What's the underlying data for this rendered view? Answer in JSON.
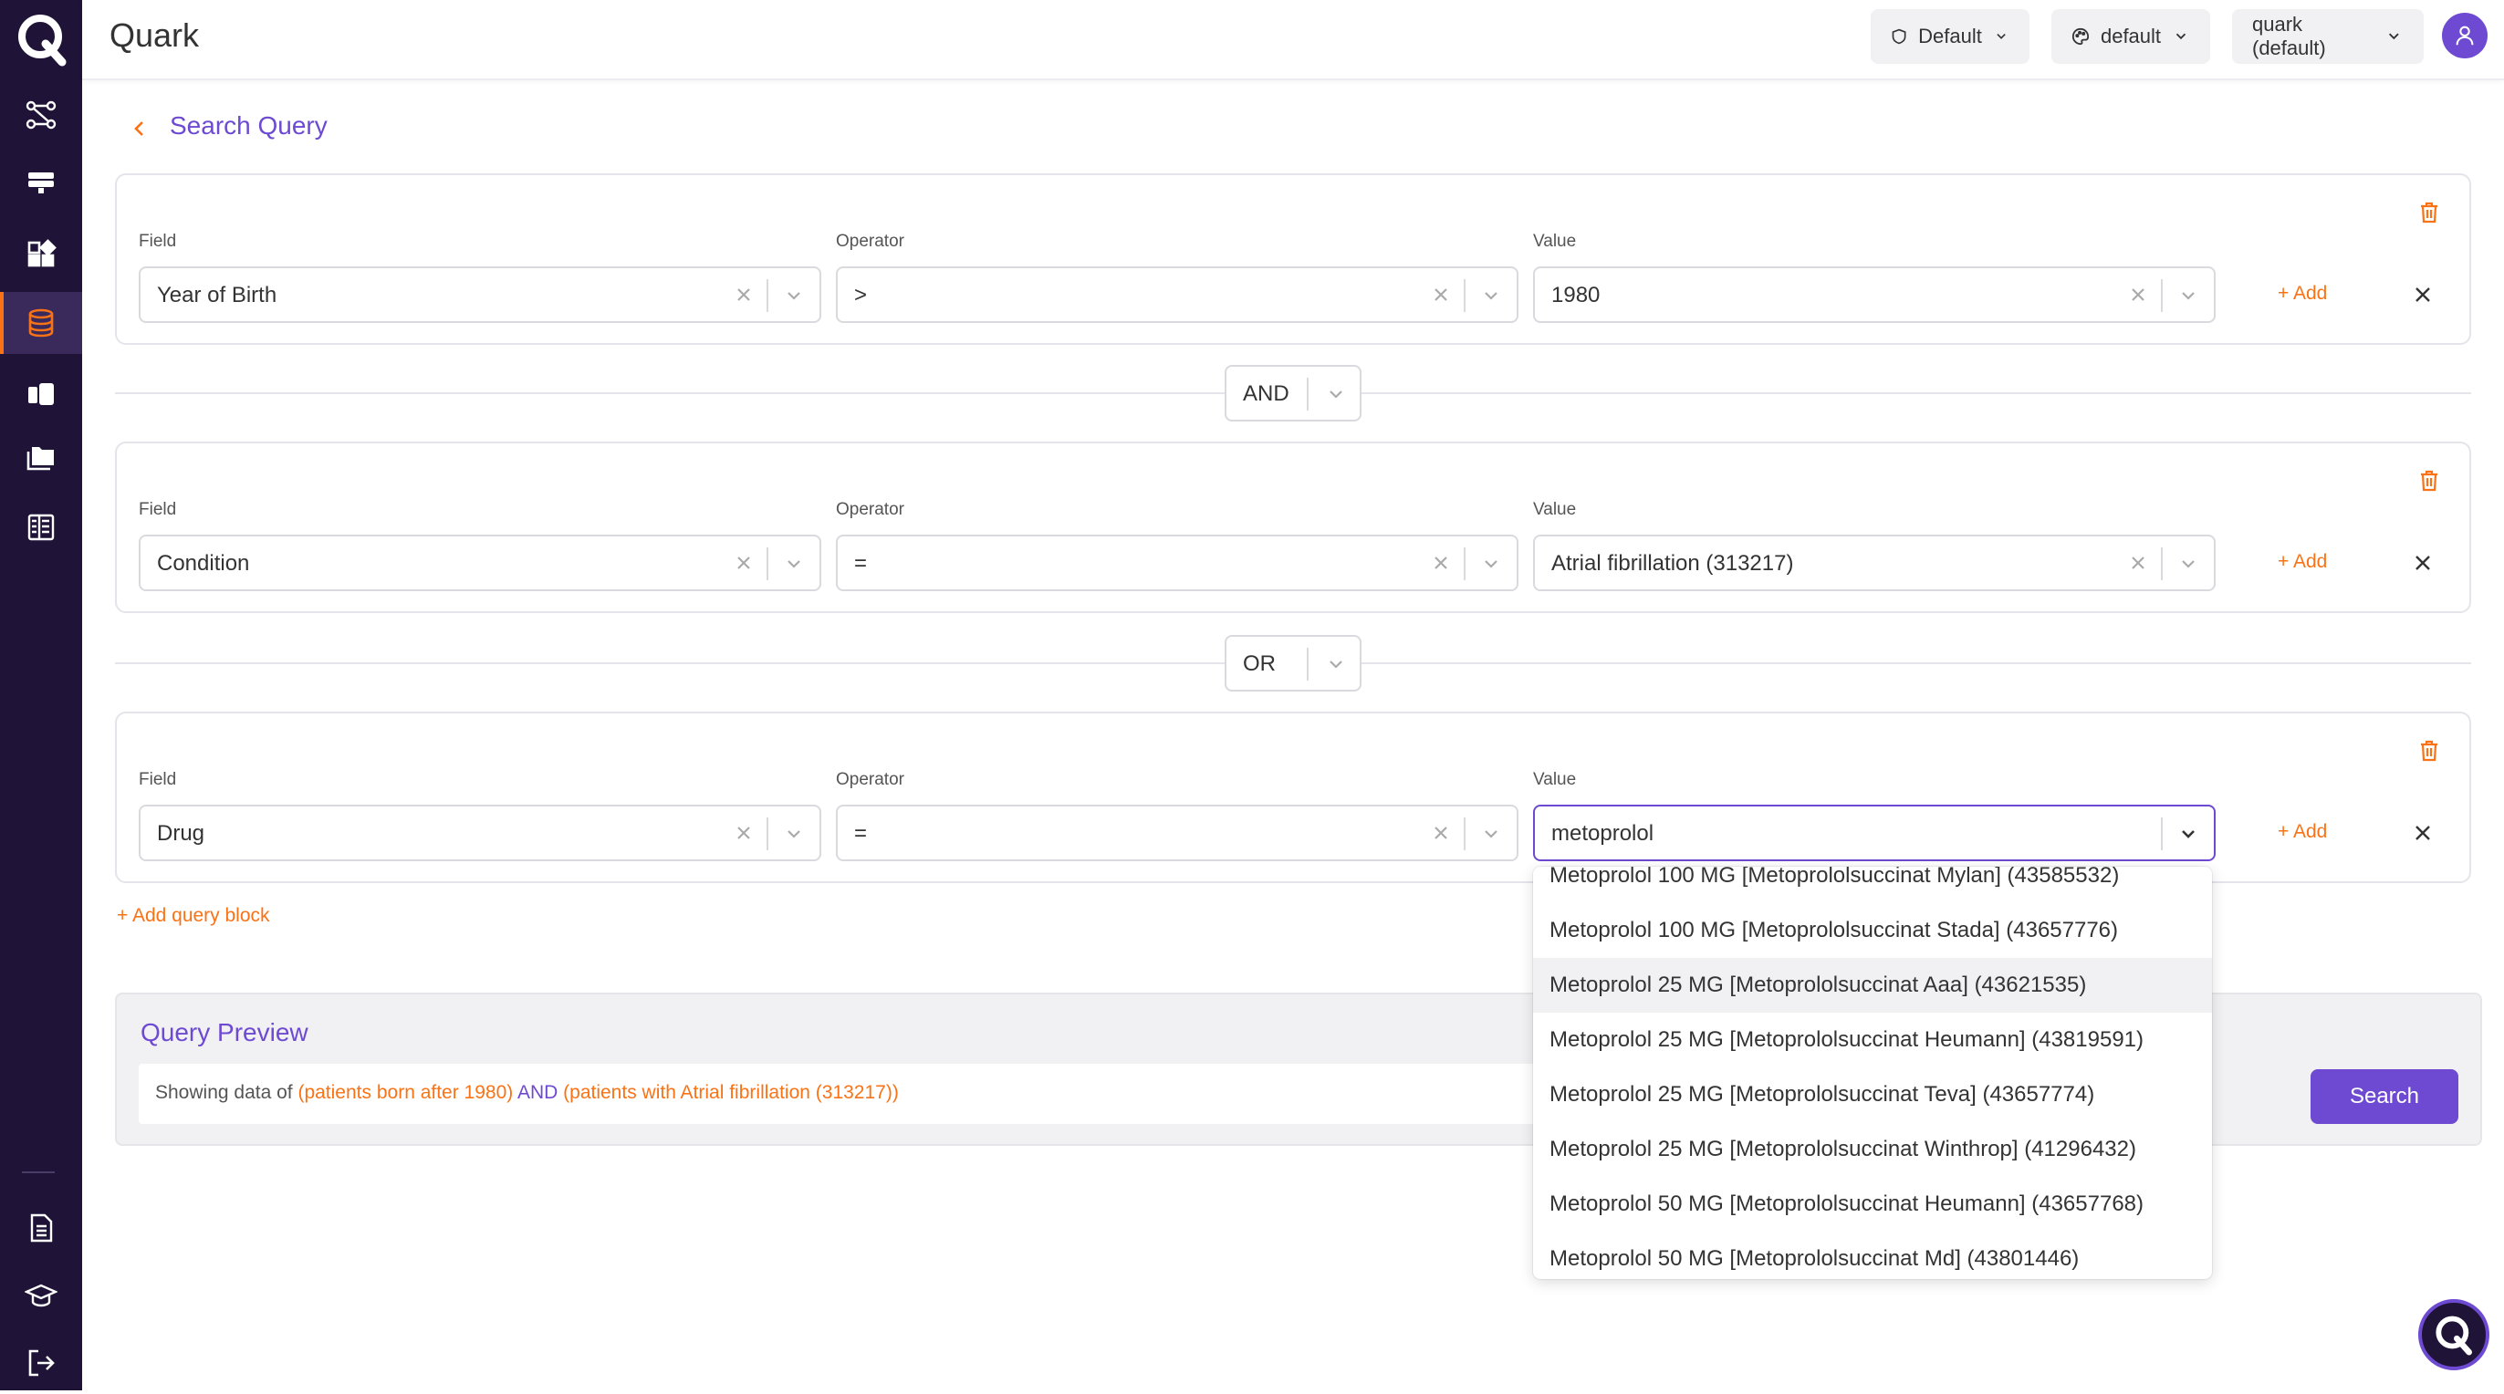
{
  "app": {
    "title": "Quark"
  },
  "topbar": {
    "dropdowns": [
      {
        "label": "Default",
        "icon": "shield-icon"
      },
      {
        "label": "default",
        "icon": "palette-icon"
      },
      {
        "label": "quark (default)",
        "icon": ""
      }
    ],
    "avatar_icon": "user-icon"
  },
  "sidebar": {
    "items": [
      {
        "name": "workflow",
        "icon": "workflow-icon",
        "active": false
      },
      {
        "name": "server",
        "icon": "server-icon",
        "active": false
      },
      {
        "name": "widgets",
        "icon": "widgets-icon",
        "active": false
      },
      {
        "name": "database",
        "icon": "database-icon",
        "active": true
      },
      {
        "name": "notebook",
        "icon": "book-icon",
        "active": false
      },
      {
        "name": "folders",
        "icon": "folders-icon",
        "active": false
      },
      {
        "name": "table",
        "icon": "table-icon",
        "active": false
      }
    ],
    "bottom_items": [
      {
        "name": "documentation",
        "icon": "document-icon"
      },
      {
        "name": "learn",
        "icon": "graduation-cap-icon"
      },
      {
        "name": "logout",
        "icon": "logout-icon"
      }
    ]
  },
  "page": {
    "back_icon": "chevron-left-icon",
    "title": "Search Query"
  },
  "labels": {
    "field": "Field",
    "operator": "Operator",
    "value": "Value",
    "add": "+ Add"
  },
  "blocks": [
    {
      "field": "Year of Birth",
      "operator": ">",
      "value": "1980"
    },
    {
      "field": "Condition",
      "operator": "=",
      "value": "Atrial fibrillation (313217)"
    },
    {
      "field": "Drug",
      "operator": "=",
      "value": "metoprolol"
    }
  ],
  "connectors": [
    "AND",
    "OR"
  ],
  "add_query_block": "+ Add query block",
  "preview": {
    "title": "Query Preview",
    "prefix": "Showing data of ",
    "paren_open_1": "(",
    "clause_1": "patients born after 1980",
    "paren_close_1": ")",
    "operator": " AND ",
    "paren_open_2": "(",
    "clause_2": "patients with Atrial fibrillation (313217)",
    "paren_close_2": ")"
  },
  "search_button": "Search",
  "dropdown_options": [
    "Metoprolol 100 MG [Metoprololsuccinat Mylan] (43585532)",
    "Metoprolol 100 MG [Metoprololsuccinat Stada] (43657776)",
    "Metoprolol 25 MG [Metoprololsuccinat Aaa] (43621535)",
    "Metoprolol 25 MG [Metoprololsuccinat Heumann] (43819591)",
    "Metoprolol 25 MG [Metoprololsuccinat Teva] (43657774)",
    "Metoprolol 25 MG [Metoprololsuccinat Winthrop] (41296432)",
    "Metoprolol 50 MG [Metoprololsuccinat Heumann] (43657768)",
    "Metoprolol 50 MG [Metoprololsuccinat Md] (43801446)"
  ],
  "highlighted_option": "Metoprolol 25 MG [Metoprololsuccinat Aaa] (43621535)",
  "colors": {
    "sidebar": "#1f1437",
    "accent": "#6d4ad1",
    "orange": "#f97316"
  }
}
